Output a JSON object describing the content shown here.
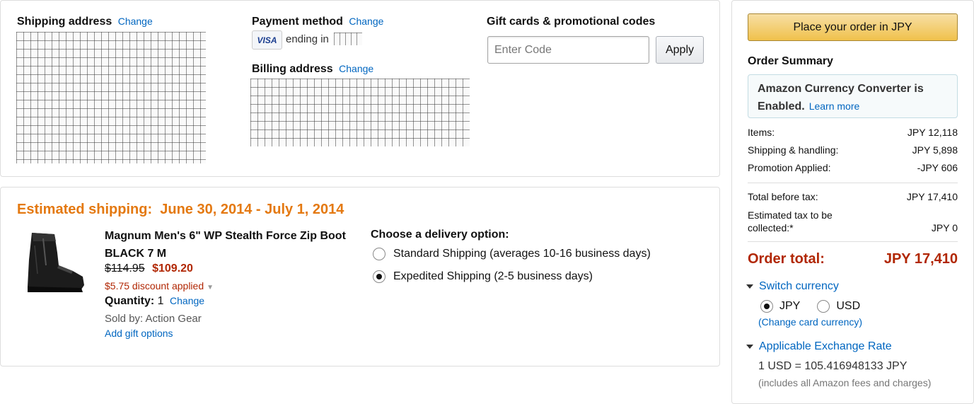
{
  "shipping_address": {
    "title": "Shipping address",
    "change": "Change"
  },
  "payment_method": {
    "title": "Payment method",
    "change": "Change",
    "card_brand": "VISA",
    "ending_text": "ending in"
  },
  "billing_address": {
    "title": "Billing address",
    "change": "Change"
  },
  "gift_cards": {
    "title": "Gift cards & promotional codes",
    "input_placeholder": "Enter Code",
    "input_value": "",
    "apply_label": "Apply"
  },
  "shipment": {
    "estimated_label": "Estimated shipping:",
    "estimated_dates": "June 30, 2014 - July 1, 2014",
    "product": {
      "title": "Magnum Men's 6\" WP Stealth Force Zip Boot BLACK 7 M",
      "old_price": "$114.95",
      "new_price": "$109.20",
      "discount": "$5.75 discount applied",
      "quantity_label": "Quantity:",
      "quantity_value": "1",
      "quantity_change": "Change",
      "sold_by": "Sold by: Action Gear",
      "gift_options": "Add gift options"
    },
    "delivery": {
      "title": "Choose a delivery option:",
      "options": [
        {
          "label": "Standard Shipping (averages 10-16 business days)",
          "selected": false
        },
        {
          "label": "Expedited Shipping (2-5 business days)",
          "selected": true
        }
      ]
    }
  },
  "sidebar": {
    "place_order_label": "Place your order in JPY",
    "summary_title": "Order Summary",
    "converter_text": "Amazon Currency Converter is Enabled.",
    "converter_link": "Learn more",
    "lines": [
      {
        "label": "Items:",
        "value": "JPY 12,118"
      },
      {
        "label": "Shipping & handling:",
        "value": "JPY 5,898"
      },
      {
        "label": "Promotion Applied:",
        "value": "-JPY 606"
      },
      {
        "label": "Total before tax:",
        "value": "JPY 17,410"
      },
      {
        "label": "Estimated tax to be collected:*",
        "value": "JPY 0"
      }
    ],
    "order_total_label": "Order total:",
    "order_total_value": "JPY 17,410",
    "switch_currency_label": "Switch currency",
    "currencies": [
      {
        "label": "JPY",
        "selected": true
      },
      {
        "label": "USD",
        "selected": false
      }
    ],
    "change_card_currency": "(Change card currency)",
    "exchange_rate_label": "Applicable Exchange Rate",
    "exchange_rate_value": "1 USD = 105.416948133 JPY",
    "exchange_rate_note": "(includes all Amazon fees and charges)"
  },
  "colors": {
    "accent_orange": "#e47911",
    "price_red": "#b12704",
    "link_blue": "#0066c0",
    "button_gold": "#f0c14b"
  }
}
